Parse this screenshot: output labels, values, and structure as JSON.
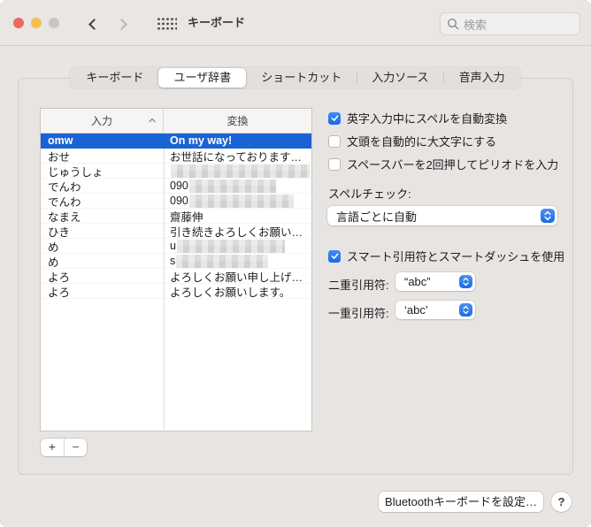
{
  "colors": {
    "accent": "#2272e8",
    "selection": "#1a63d4",
    "checkbox_checked": "#1b6ae2"
  },
  "window": {
    "title": "キーボード"
  },
  "toolbar": {
    "search_placeholder": "検索"
  },
  "tabs": [
    {
      "label": "キーボード",
      "selected": false
    },
    {
      "label": "ユーザ辞書",
      "selected": true
    },
    {
      "label": "ショートカット",
      "selected": false
    },
    {
      "label": "入力ソース",
      "selected": false
    },
    {
      "label": "音声入力",
      "selected": false
    }
  ],
  "dictionary_table": {
    "columns": [
      {
        "label": "入力",
        "sort": "asc"
      },
      {
        "label": "変換",
        "sort": null
      }
    ],
    "rows": [
      {
        "input": "omw",
        "conversion": "On my way!",
        "selected": true,
        "redacted_width": 0
      },
      {
        "input": "おせ",
        "conversion": "お世話になっております…",
        "selected": false,
        "redacted_width": 0
      },
      {
        "input": "じゅうしょ",
        "conversion": "",
        "selected": false,
        "redacted_width": 157
      },
      {
        "input": "でんわ",
        "conversion": "090",
        "selected": false,
        "redacted_width": 98
      },
      {
        "input": "でんわ",
        "conversion": "090",
        "selected": false,
        "redacted_width": 118
      },
      {
        "input": "なまえ",
        "conversion": "齋藤伸",
        "selected": false,
        "redacted_width": 0
      },
      {
        "input": "ひき",
        "conversion": "引き続きよろしくお願い…",
        "selected": false,
        "redacted_width": 0
      },
      {
        "input": "め",
        "conversion": "u",
        "selected": false,
        "redacted_width": 122
      },
      {
        "input": "め",
        "conversion": "s",
        "selected": false,
        "redacted_width": 104
      },
      {
        "input": "よろ",
        "conversion": "よろしくお願い申し上げ…",
        "selected": false,
        "redacted_width": 0
      },
      {
        "input": "よろ",
        "conversion": "よろしくお願いします。",
        "selected": false,
        "redacted_width": 0
      }
    ],
    "add_label": "+",
    "remove_label": "−"
  },
  "options": {
    "checkboxes": [
      {
        "label": "英字入力中にスペルを自動変換",
        "checked": true
      },
      {
        "label": "文頭を自動的に大文字にする",
        "checked": false
      },
      {
        "label": "スペースバーを2回押してピリオドを入力",
        "checked": false
      }
    ],
    "spellcheck_label": "スペルチェック:",
    "spellcheck_value": "言語ごとに自動",
    "smart_quotes": {
      "label": "スマート引用符とスマートダッシュを使用",
      "checked": true
    },
    "double_quote_label": "二重引用符:",
    "double_quote_value": "“abc”",
    "single_quote_label": "一重引用符:",
    "single_quote_value": "‘abc’"
  },
  "footer": {
    "bluetooth_button": "Bluetoothキーボードを設定…",
    "help_button": "?"
  }
}
